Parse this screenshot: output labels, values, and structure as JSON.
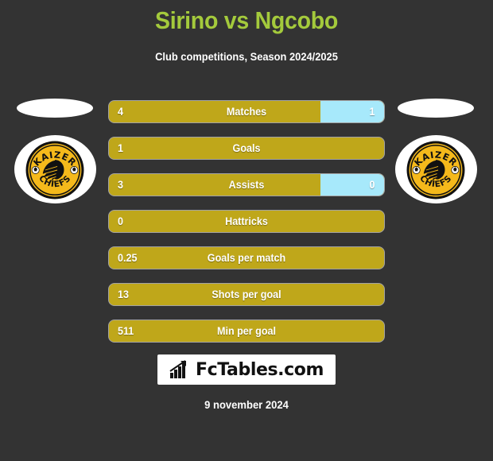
{
  "header": {
    "title": "Sirino vs Ngcobo",
    "subtitle": "Club competitions, Season 2024/2025"
  },
  "colors": {
    "background": "#333333",
    "title_green": "#a4ca3c",
    "bar_gold": "#bfa71a",
    "bar_blue": "#a7e9fb",
    "crest_white": "#ffffff",
    "crest_yellow": "#f5b91b",
    "crest_black": "#111111"
  },
  "crests": {
    "left": {
      "club": "Kaizer Chiefs",
      "top_text": "KAIZER",
      "bottom_text": "CHIEFS"
    },
    "right": {
      "club": "Kaizer Chiefs",
      "top_text": "KAIZER",
      "bottom_text": "CHIEFS"
    }
  },
  "chart_data": {
    "type": "bar",
    "title": "Sirino vs Ngcobo",
    "subtitle": "Club competitions, Season 2024/2025",
    "orientation": "horizontal-diverging",
    "series": [
      {
        "name": "Sirino",
        "side": "left",
        "color": "#bfa71a"
      },
      {
        "name": "Ngcobo",
        "side": "right",
        "color": "#a7e9fb"
      }
    ],
    "categories": [
      "Matches",
      "Goals",
      "Assists",
      "Hattricks",
      "Goals per match",
      "Shots per goal",
      "Min per goal"
    ],
    "rows": [
      {
        "label": "Matches",
        "left_value": "4",
        "right_value": "1",
        "left_pct": 77,
        "right_pct": 23,
        "has_right": true
      },
      {
        "label": "Goals",
        "left_value": "1",
        "right_value": "",
        "left_pct": 100,
        "right_pct": 0,
        "has_right": false
      },
      {
        "label": "Assists",
        "left_value": "3",
        "right_value": "0",
        "left_pct": 77,
        "right_pct": 23,
        "has_right": true
      },
      {
        "label": "Hattricks",
        "left_value": "0",
        "right_value": "",
        "left_pct": 100,
        "right_pct": 0,
        "has_right": false
      },
      {
        "label": "Goals per match",
        "left_value": "0.25",
        "right_value": "",
        "left_pct": 100,
        "right_pct": 0,
        "has_right": false
      },
      {
        "label": "Shots per goal",
        "left_value": "13",
        "right_value": "",
        "left_pct": 100,
        "right_pct": 0,
        "has_right": false
      },
      {
        "label": "Min per goal",
        "left_value": "511",
        "right_value": "",
        "left_pct": 100,
        "right_pct": 0,
        "has_right": false
      }
    ]
  },
  "branding": {
    "name": "FcTables.com",
    "icon": "bar-chart-arrow-icon"
  },
  "footer": {
    "date": "9 november 2024"
  }
}
